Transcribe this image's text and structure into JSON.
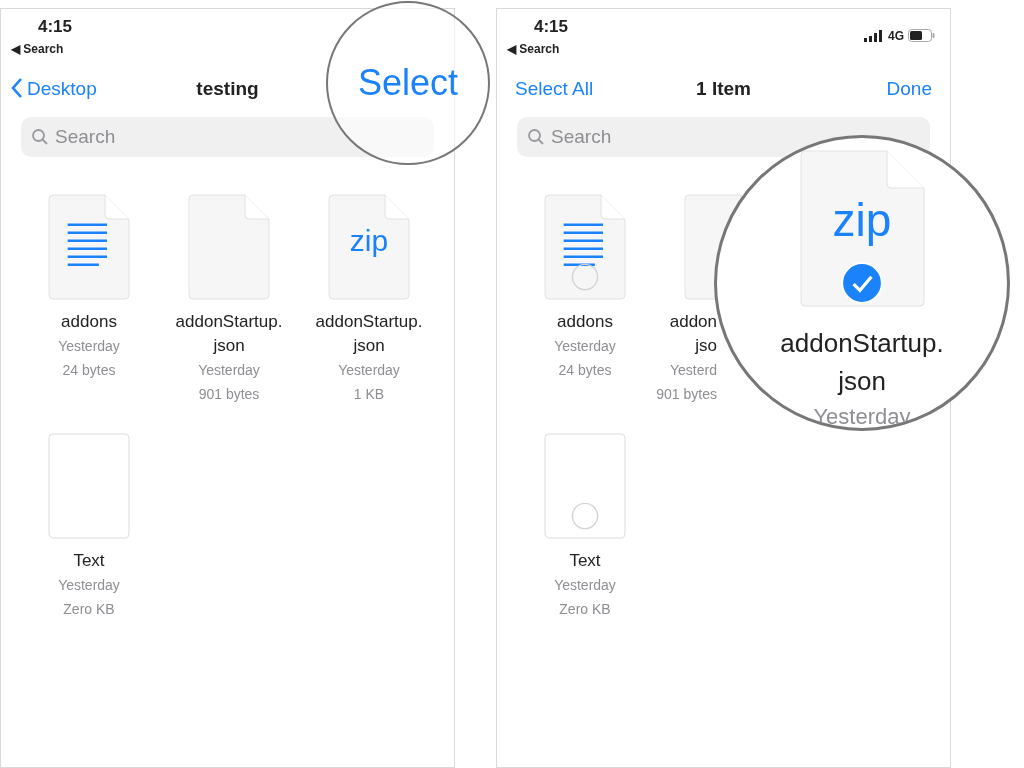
{
  "panels": [
    {
      "status_bar": {
        "time": "4:15",
        "back_label": "◀ Search"
      },
      "nav": {
        "left": {
          "text": "Desktop",
          "kind": "back"
        },
        "title": "testing",
        "right": "Select",
        "right_magnified": true
      },
      "search": {
        "placeholder": "Search"
      },
      "files": [
        {
          "kind": "lines",
          "name_lines": [
            "addons"
          ],
          "date": "Yesterday",
          "size": "24 bytes"
        },
        {
          "kind": "blank",
          "name_lines": [
            "addonStartup.",
            "json"
          ],
          "date": "Yesterday",
          "size": "901 bytes"
        },
        {
          "kind": "zip",
          "label": "zip",
          "name_lines": [
            "addonStartup.",
            "json"
          ],
          "date": "Yesterday",
          "size": "1 KB"
        },
        {
          "kind": "plain",
          "name_lines": [
            "Text"
          ],
          "date": "Yesterday",
          "size": "Zero KB"
        }
      ]
    },
    {
      "status_bar": {
        "time": "4:15",
        "back_label": "◀ Search",
        "network": "4G"
      },
      "nav": {
        "left": {
          "text": "Select All",
          "kind": "plain"
        },
        "title": "1 Item",
        "right": "Done",
        "right_magnified": false
      },
      "search": {
        "placeholder": "Search"
      },
      "files": [
        {
          "kind": "lines",
          "name_lines": [
            "addons"
          ],
          "date": "Yesterday",
          "size": "24 bytes",
          "selected": false
        },
        {
          "kind": "blank",
          "name_lines": [
            "addon",
            "jso"
          ],
          "date": "Yesterd",
          "size": "901 bytes",
          "clipped": true
        },
        {
          "kind": "zip",
          "label": "zip",
          "name_lines": [
            "addonStartup.",
            "json"
          ],
          "date": "Yesterday",
          "selected": true,
          "magnified": true
        },
        {
          "kind": "plain",
          "name_lines": [
            "Text"
          ],
          "date": "Yesterday",
          "size": "Zero KB",
          "selected": false
        }
      ]
    }
  ]
}
